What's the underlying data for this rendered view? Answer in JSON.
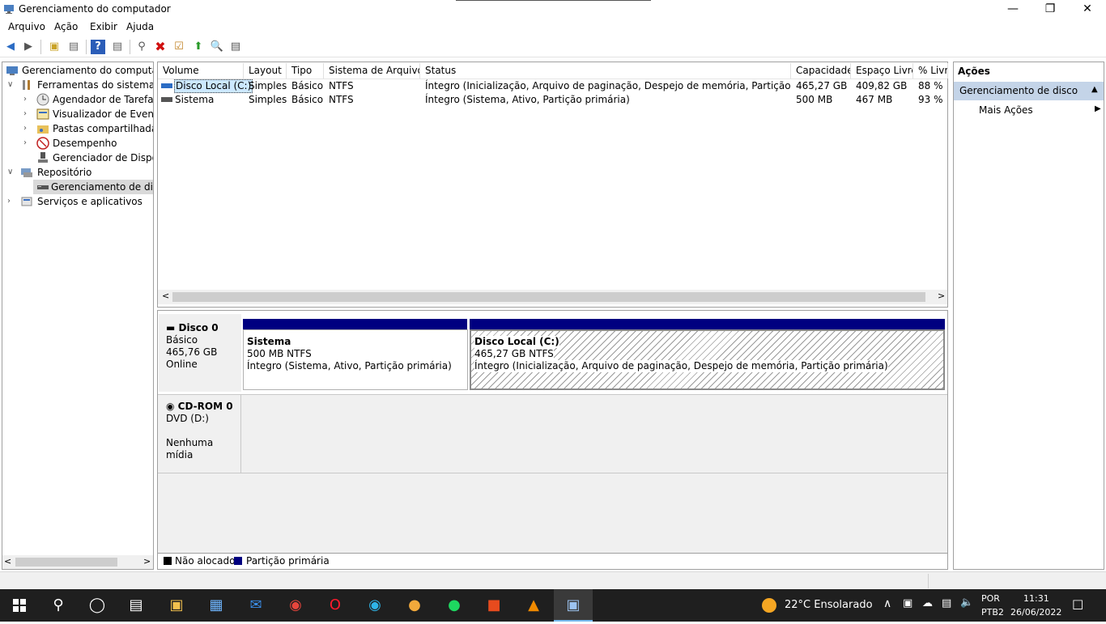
{
  "window": {
    "title": "Gerenciamento do computador",
    "minimize": "—",
    "maximize": "❐",
    "close": "✕"
  },
  "menu": [
    "Arquivo",
    "Ação",
    "Exibir",
    "Ajuda"
  ],
  "tree": {
    "root": "Gerenciamento do computador (Local)",
    "system_tools": "Ferramentas do sistema",
    "task_scheduler": "Agendador de Tarefas",
    "event_viewer": "Visualizador de Eventos",
    "shared_folders": "Pastas compartilhadas",
    "performance": "Desempenho",
    "device_manager": "Gerenciador de Dispositivos",
    "storage": "Repositório",
    "disk_management": "Gerenciamento de disco",
    "services": "Serviços e aplicativos"
  },
  "volumes": {
    "headers": [
      "Volume",
      "Layout",
      "Tipo",
      "Sistema de Arquivos",
      "Status",
      "Capacidade",
      "Espaço Livre",
      "% Livre"
    ],
    "rows": [
      [
        "Disco Local (C:)",
        "Simples",
        "Básico",
        "NTFS",
        "Íntegro (Inicialização, Arquivo de paginação, Despejo de memória, Partição primária)",
        "465,27 GB",
        "409,82 GB",
        "88 %"
      ],
      [
        "Sistema",
        "Simples",
        "Básico",
        "NTFS",
        "Íntegro (Sistema, Ativo, Partição primária)",
        "500 MB",
        "467 MB",
        "93 %"
      ]
    ]
  },
  "disks": {
    "disk0": {
      "name": "Disco 0",
      "type": "Básico",
      "size": "465,76 GB",
      "state": "Online"
    },
    "cdrom": {
      "name": "CD-ROM 0",
      "drive": "DVD (D:)",
      "media": "Nenhuma mídia"
    },
    "partitions": [
      {
        "name": "Sistema",
        "size": "500 MB NTFS",
        "status": "Íntegro (Sistema, Ativo, Partição primária)"
      },
      {
        "name": "Disco Local  (C:)",
        "size": "465,27 GB NTFS",
        "status": "Íntegro (Inicialização, Arquivo de paginação, Despejo de memória, Partição primária)"
      }
    ]
  },
  "legend": {
    "unallocated": "Não alocado",
    "primary": "Partição primária"
  },
  "actions": {
    "header": "Ações",
    "section": "Gerenciamento de disco",
    "more": "Mais Ações"
  },
  "taskbar": {
    "weather": "22°C  Ensolarado",
    "lang1": "POR",
    "lang2": "PTB2",
    "time": "11:31",
    "date": "26/06/2022"
  },
  "colors": {
    "primary_partition": "#000080",
    "selected": "#cce8ff",
    "taskbar": "#1f1f1f"
  }
}
